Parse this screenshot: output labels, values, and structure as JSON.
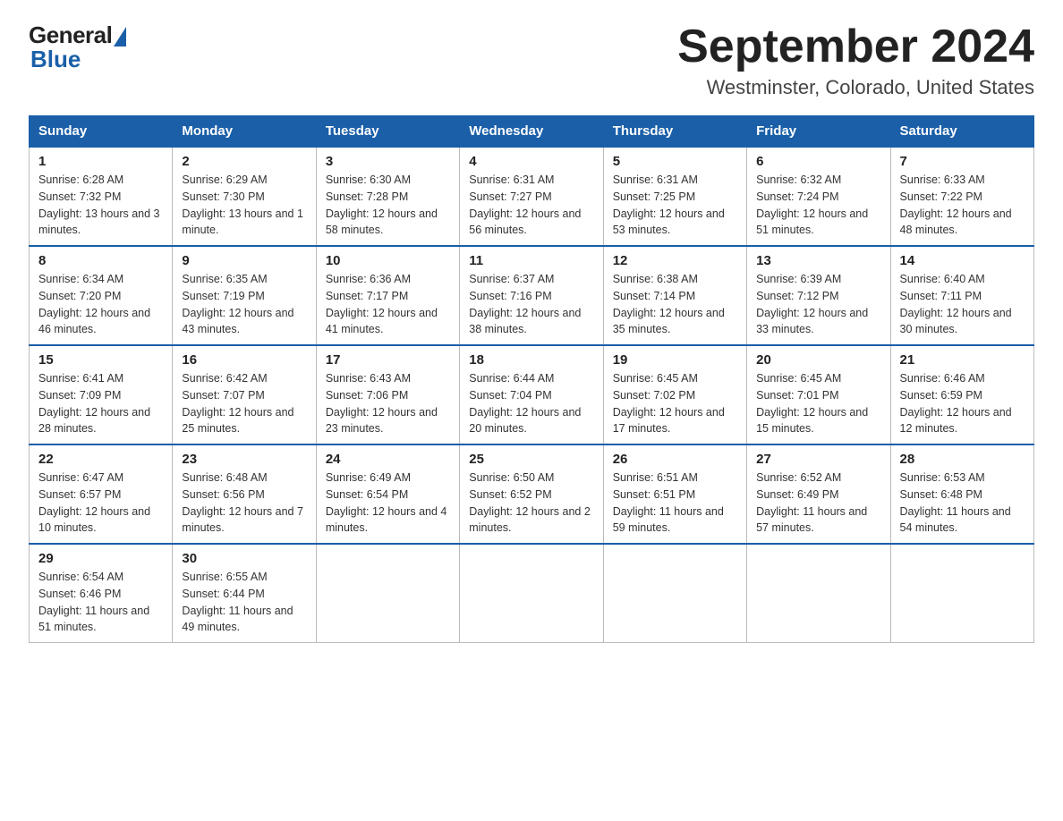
{
  "logo": {
    "text_general": "General",
    "text_blue": "Blue"
  },
  "title": "September 2024",
  "location": "Westminster, Colorado, United States",
  "days_of_week": [
    "Sunday",
    "Monday",
    "Tuesday",
    "Wednesday",
    "Thursday",
    "Friday",
    "Saturday"
  ],
  "weeks": [
    [
      {
        "day": "1",
        "sunrise": "6:28 AM",
        "sunset": "7:32 PM",
        "daylight": "13 hours and 3 minutes."
      },
      {
        "day": "2",
        "sunrise": "6:29 AM",
        "sunset": "7:30 PM",
        "daylight": "13 hours and 1 minute."
      },
      {
        "day": "3",
        "sunrise": "6:30 AM",
        "sunset": "7:28 PM",
        "daylight": "12 hours and 58 minutes."
      },
      {
        "day": "4",
        "sunrise": "6:31 AM",
        "sunset": "7:27 PM",
        "daylight": "12 hours and 56 minutes."
      },
      {
        "day": "5",
        "sunrise": "6:31 AM",
        "sunset": "7:25 PM",
        "daylight": "12 hours and 53 minutes."
      },
      {
        "day": "6",
        "sunrise": "6:32 AM",
        "sunset": "7:24 PM",
        "daylight": "12 hours and 51 minutes."
      },
      {
        "day": "7",
        "sunrise": "6:33 AM",
        "sunset": "7:22 PM",
        "daylight": "12 hours and 48 minutes."
      }
    ],
    [
      {
        "day": "8",
        "sunrise": "6:34 AM",
        "sunset": "7:20 PM",
        "daylight": "12 hours and 46 minutes."
      },
      {
        "day": "9",
        "sunrise": "6:35 AM",
        "sunset": "7:19 PM",
        "daylight": "12 hours and 43 minutes."
      },
      {
        "day": "10",
        "sunrise": "6:36 AM",
        "sunset": "7:17 PM",
        "daylight": "12 hours and 41 minutes."
      },
      {
        "day": "11",
        "sunrise": "6:37 AM",
        "sunset": "7:16 PM",
        "daylight": "12 hours and 38 minutes."
      },
      {
        "day": "12",
        "sunrise": "6:38 AM",
        "sunset": "7:14 PM",
        "daylight": "12 hours and 35 minutes."
      },
      {
        "day": "13",
        "sunrise": "6:39 AM",
        "sunset": "7:12 PM",
        "daylight": "12 hours and 33 minutes."
      },
      {
        "day": "14",
        "sunrise": "6:40 AM",
        "sunset": "7:11 PM",
        "daylight": "12 hours and 30 minutes."
      }
    ],
    [
      {
        "day": "15",
        "sunrise": "6:41 AM",
        "sunset": "7:09 PM",
        "daylight": "12 hours and 28 minutes."
      },
      {
        "day": "16",
        "sunrise": "6:42 AM",
        "sunset": "7:07 PM",
        "daylight": "12 hours and 25 minutes."
      },
      {
        "day": "17",
        "sunrise": "6:43 AM",
        "sunset": "7:06 PM",
        "daylight": "12 hours and 23 minutes."
      },
      {
        "day": "18",
        "sunrise": "6:44 AM",
        "sunset": "7:04 PM",
        "daylight": "12 hours and 20 minutes."
      },
      {
        "day": "19",
        "sunrise": "6:45 AM",
        "sunset": "7:02 PM",
        "daylight": "12 hours and 17 minutes."
      },
      {
        "day": "20",
        "sunrise": "6:45 AM",
        "sunset": "7:01 PM",
        "daylight": "12 hours and 15 minutes."
      },
      {
        "day": "21",
        "sunrise": "6:46 AM",
        "sunset": "6:59 PM",
        "daylight": "12 hours and 12 minutes."
      }
    ],
    [
      {
        "day": "22",
        "sunrise": "6:47 AM",
        "sunset": "6:57 PM",
        "daylight": "12 hours and 10 minutes."
      },
      {
        "day": "23",
        "sunrise": "6:48 AM",
        "sunset": "6:56 PM",
        "daylight": "12 hours and 7 minutes."
      },
      {
        "day": "24",
        "sunrise": "6:49 AM",
        "sunset": "6:54 PM",
        "daylight": "12 hours and 4 minutes."
      },
      {
        "day": "25",
        "sunrise": "6:50 AM",
        "sunset": "6:52 PM",
        "daylight": "12 hours and 2 minutes."
      },
      {
        "day": "26",
        "sunrise": "6:51 AM",
        "sunset": "6:51 PM",
        "daylight": "11 hours and 59 minutes."
      },
      {
        "day": "27",
        "sunrise": "6:52 AM",
        "sunset": "6:49 PM",
        "daylight": "11 hours and 57 minutes."
      },
      {
        "day": "28",
        "sunrise": "6:53 AM",
        "sunset": "6:48 PM",
        "daylight": "11 hours and 54 minutes."
      }
    ],
    [
      {
        "day": "29",
        "sunrise": "6:54 AM",
        "sunset": "6:46 PM",
        "daylight": "11 hours and 51 minutes."
      },
      {
        "day": "30",
        "sunrise": "6:55 AM",
        "sunset": "6:44 PM",
        "daylight": "11 hours and 49 minutes."
      },
      null,
      null,
      null,
      null,
      null
    ]
  ]
}
